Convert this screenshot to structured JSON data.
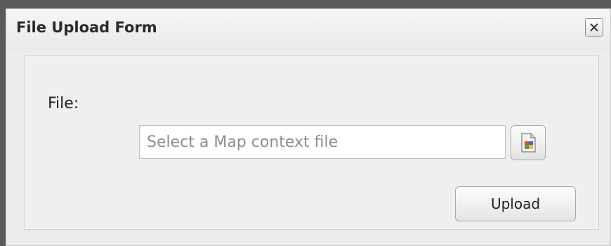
{
  "dialog": {
    "title": "File Upload Form",
    "close_icon": "close-icon"
  },
  "form": {
    "file_label": "File:",
    "file_input": {
      "placeholder": "Select a Map context file",
      "value": ""
    },
    "browse_icon": "file-browse-icon",
    "upload_label": "Upload"
  },
  "colors": {
    "overlay_background": "#5a5a5a",
    "window_background": "#ececec",
    "panel_background": "#efefef",
    "border": "#c9c9c9"
  }
}
